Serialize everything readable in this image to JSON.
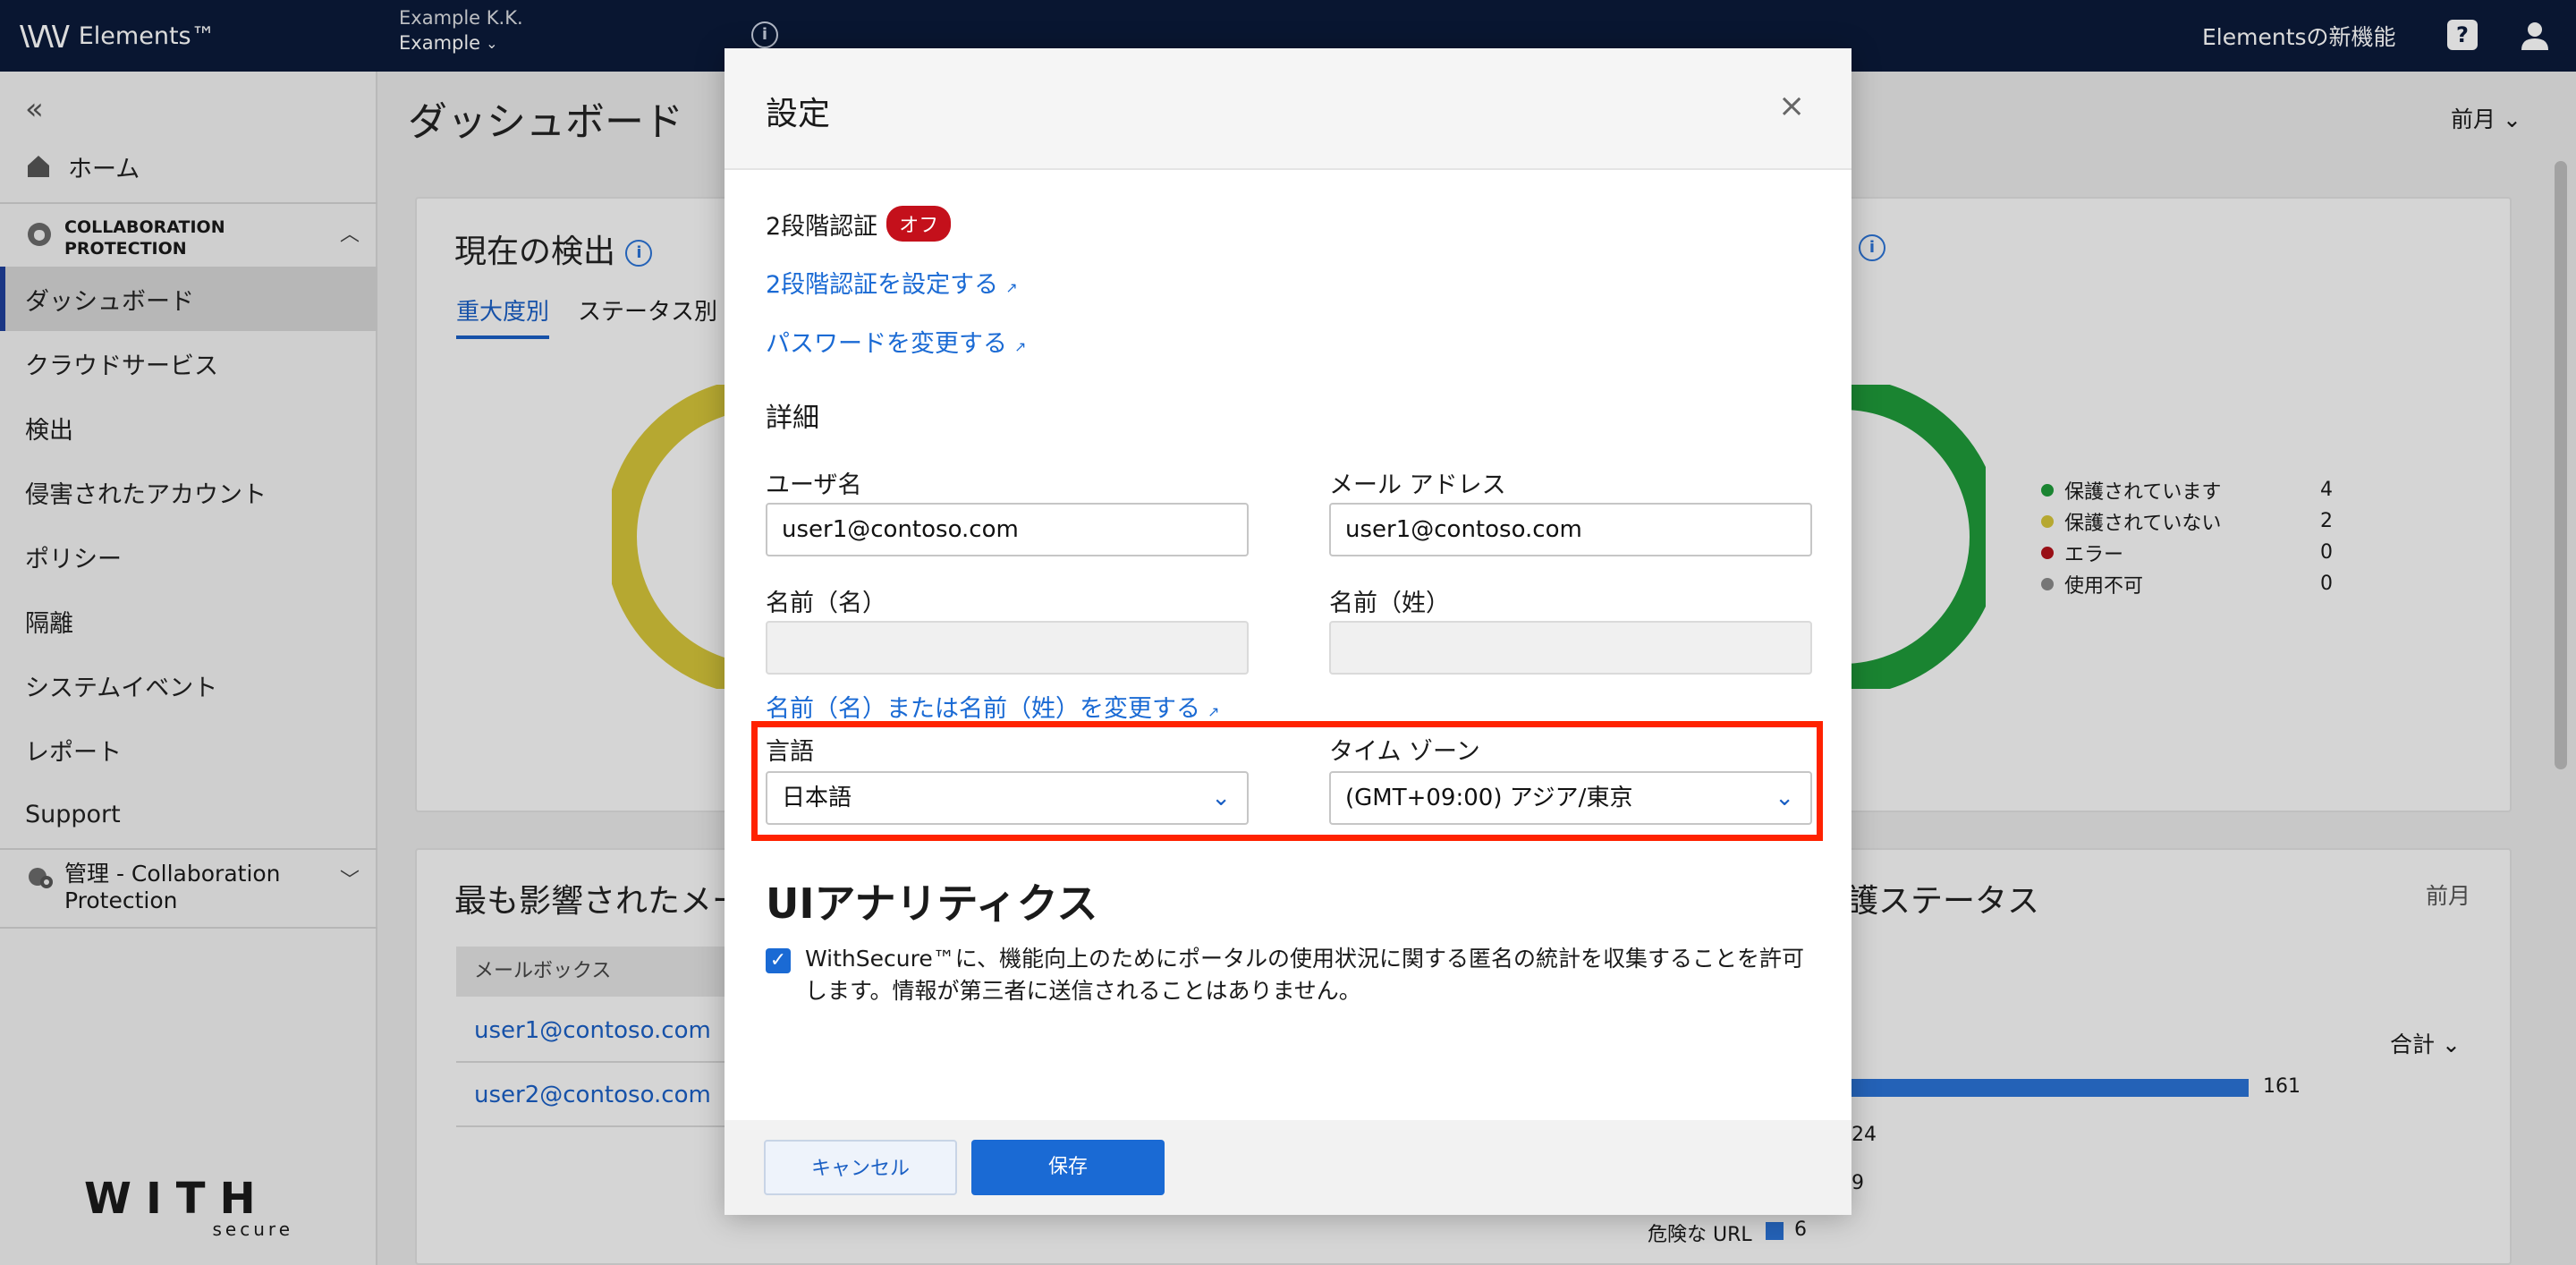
{
  "topbar": {
    "brand_name": "Elements™",
    "company": "Example K.K.",
    "scope": "Example",
    "whats_new": "Elementsの新機能"
  },
  "sidebar": {
    "home": "ホーム",
    "section_title": "COLLABORATION PROTECTION",
    "items": [
      "ダッシュボード",
      "クラウドサービス",
      "検出",
      "侵害されたアカウント",
      "ポリシー",
      "隔離",
      "システムイベント",
      "レポート",
      "Support"
    ],
    "admin_label": "管理 - Collaboration Protection",
    "footer_logo": "WITH",
    "footer_logo_sub": "secure"
  },
  "main": {
    "title": "ダッシュボード",
    "period": "前月",
    "detections_title": "現在の検出",
    "tabs": [
      "重大度別",
      "ステータス別"
    ],
    "legend": [
      {
        "name": "保護されています",
        "value": "4",
        "color": "#1f9a3a"
      },
      {
        "name": "保護されていない",
        "value": "2",
        "color": "#d4c43a"
      },
      {
        "name": "エラー",
        "value": "0",
        "color": "#b3121a"
      },
      {
        "name": "使用不可",
        "value": "0",
        "color": "#8a8a8a"
      }
    ],
    "affected_title": "最も影響されたメー",
    "table_header": "メールボックス",
    "mailboxes": [
      "user1@contoso.com",
      "user2@contoso.com"
    ],
    "status_title": "護ステータス",
    "status_period": "前月",
    "total_label": "合計",
    "bars": [
      {
        "label": "",
        "value": 161
      },
      {
        "label": "",
        "value": 24
      },
      {
        "label": "",
        "value": 9
      },
      {
        "label": "危険な URL",
        "value": 6
      }
    ]
  },
  "modal": {
    "title": "設定",
    "two_factor_label": "2段階認証",
    "two_factor_status": "オフ",
    "setup_2fa_link": "2段階認証を設定する",
    "change_password_link": "パスワードを変更する",
    "details_heading": "詳細",
    "username_label": "ユーザ名",
    "username_value": "user1@contoso.com",
    "email_label": "メール アドレス",
    "email_value": "user1@contoso.com",
    "first_name_label": "名前（名）",
    "last_name_label": "名前（姓）",
    "change_name_link": "名前（名）または名前（姓）を変更する",
    "language_label": "言語",
    "language_value": "日本語",
    "timezone_label": "タイム ゾーン",
    "timezone_value": "(GMT+09:00) アジア/東京",
    "analytics_title": "UIアナリティクス",
    "analytics_consent": "WithSecure™に、機能向上のためにポータルの使用状況に関する匿名の統計を収集することを許可します。情報が第三者に送信されることはありません。",
    "cancel_label": "キャンセル",
    "save_label": "保存"
  }
}
